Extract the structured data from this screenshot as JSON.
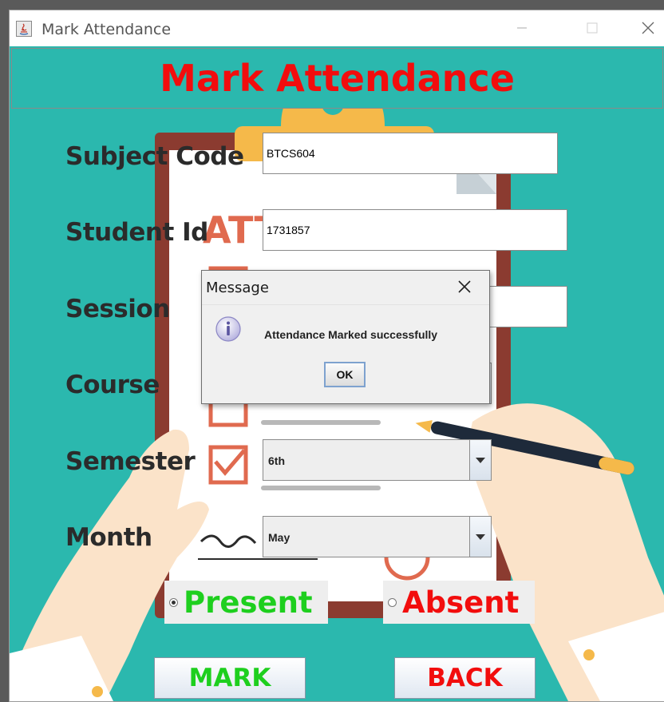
{
  "window": {
    "title": "Mark Attendance"
  },
  "header": {
    "title": "Mark Attendance"
  },
  "form": {
    "subject_code": {
      "label": "Subject Code",
      "value": "BTCS604"
    },
    "student_id": {
      "label": "Student Id",
      "value": "1731857"
    },
    "session": {
      "label": "Session",
      "value": ""
    },
    "course": {
      "label": "Course",
      "value": ""
    },
    "semester": {
      "label": "Semester",
      "value": "6th"
    },
    "month": {
      "label": "Month",
      "value": "May"
    }
  },
  "attendance": {
    "present_label": "Present",
    "absent_label": "Absent",
    "selected": "present"
  },
  "buttons": {
    "mark": "MARK",
    "back": "BACK"
  },
  "dialog": {
    "title": "Message",
    "message": "Attendance Marked successfully",
    "ok": "OK",
    "icon": "info-icon"
  },
  "illustration": {
    "sheet_text": "ATT"
  },
  "colors": {
    "background": "#2bb8ae",
    "title_red": "#f20d0d",
    "present_green": "#1ecf1e",
    "absent_red": "#f20d0d"
  }
}
